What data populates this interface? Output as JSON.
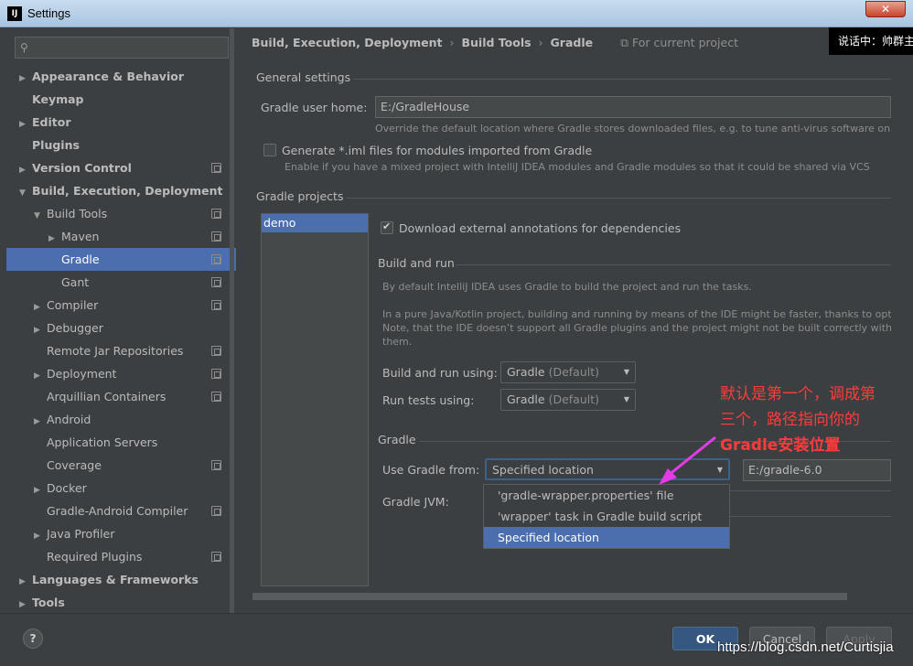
{
  "window": {
    "title": "Settings",
    "app_icon": "IJ",
    "close_symbol": "✕"
  },
  "sidebar": {
    "search_placeholder": "",
    "items": [
      {
        "label": "Appearance & Behavior",
        "arrow": "▶",
        "bold": true,
        "indent": 0,
        "copy": false
      },
      {
        "label": "Keymap",
        "arrow": "",
        "bold": true,
        "indent": 0,
        "copy": false
      },
      {
        "label": "Editor",
        "arrow": "▶",
        "bold": true,
        "indent": 0,
        "copy": false
      },
      {
        "label": "Plugins",
        "arrow": "",
        "bold": true,
        "indent": 0,
        "copy": false
      },
      {
        "label": "Version Control",
        "arrow": "▶",
        "bold": true,
        "indent": 0,
        "copy": true
      },
      {
        "label": "Build, Execution, Deployment",
        "arrow": "▼",
        "bold": true,
        "indent": 0,
        "copy": false
      },
      {
        "label": "Build Tools",
        "arrow": "▼",
        "bold": false,
        "indent": 1,
        "copy": true
      },
      {
        "label": "Maven",
        "arrow": "▶",
        "bold": false,
        "indent": 2,
        "copy": true
      },
      {
        "label": "Gradle",
        "arrow": "",
        "bold": false,
        "indent": 2,
        "copy": true,
        "selected": true
      },
      {
        "label": "Gant",
        "arrow": "",
        "bold": false,
        "indent": 2,
        "copy": true
      },
      {
        "label": "Compiler",
        "arrow": "▶",
        "bold": false,
        "indent": 1,
        "copy": true
      },
      {
        "label": "Debugger",
        "arrow": "▶",
        "bold": false,
        "indent": 1,
        "copy": false
      },
      {
        "label": "Remote Jar Repositories",
        "arrow": "",
        "bold": false,
        "indent": 1,
        "copy": true
      },
      {
        "label": "Deployment",
        "arrow": "▶",
        "bold": false,
        "indent": 1,
        "copy": true
      },
      {
        "label": "Arquillian Containers",
        "arrow": "",
        "bold": false,
        "indent": 1,
        "copy": true
      },
      {
        "label": "Android",
        "arrow": "▶",
        "bold": false,
        "indent": 1,
        "copy": false
      },
      {
        "label": "Application Servers",
        "arrow": "",
        "bold": false,
        "indent": 1,
        "copy": false
      },
      {
        "label": "Coverage",
        "arrow": "",
        "bold": false,
        "indent": 1,
        "copy": true
      },
      {
        "label": "Docker",
        "arrow": "▶",
        "bold": false,
        "indent": 1,
        "copy": false
      },
      {
        "label": "Gradle-Android Compiler",
        "arrow": "",
        "bold": false,
        "indent": 1,
        "copy": true
      },
      {
        "label": "Java Profiler",
        "arrow": "▶",
        "bold": false,
        "indent": 1,
        "copy": false
      },
      {
        "label": "Required Plugins",
        "arrow": "",
        "bold": false,
        "indent": 1,
        "copy": true
      },
      {
        "label": "Languages & Frameworks",
        "arrow": "▶",
        "bold": true,
        "indent": 0,
        "copy": false
      },
      {
        "label": "Tools",
        "arrow": "▶",
        "bold": true,
        "indent": 0,
        "copy": false
      }
    ]
  },
  "breadcrumb": {
    "parts": [
      "Build, Execution, Deployment",
      "Build Tools",
      "Gradle"
    ],
    "separator": "›",
    "project_scope": "For current project"
  },
  "general": {
    "title": "General settings",
    "user_home_label": "Gradle user home:",
    "user_home_value": "E:/GradleHouse",
    "user_home_hint": "Override the default location where Gradle stores downloaded files, e.g. to tune anti-virus software on Wind",
    "iml_label": "Generate *.iml files for modules imported from Gradle",
    "iml_hint": "Enable if you have a mixed project with IntelliJ IDEA modules and Gradle modules so that it could be shared via VCS",
    "iml_checked": false
  },
  "projects": {
    "title": "Gradle projects",
    "list": [
      "demo"
    ],
    "download_annotations_label": "Download external annotations for dependencies",
    "download_annotations_checked": true
  },
  "build_run": {
    "title": "Build and run",
    "desc1": "By default IntelliJ IDEA uses Gradle to build the project and run the tasks.",
    "desc2": "In a pure Java/Kotlin project, building and running by means of the IDE might be faster, thanks to optimiza",
    "desc3": "Note, that the IDE doesn’t support all Gradle plugins and the project might not be built correctly with sor",
    "desc4": "them.",
    "build_using_label": "Build and run using:",
    "build_using_value": "Gradle",
    "build_using_muted": "(Default)",
    "tests_using_label": "Run tests using:",
    "tests_using_value": "Gradle",
    "tests_using_muted": "(Default)"
  },
  "gradle": {
    "title": "Gradle",
    "use_from_label": "Use Gradle from:",
    "use_from_value": "Specified location",
    "location_value": "E:/gradle-6.0",
    "jvm_label": "Gradle JVM:",
    "options": [
      "'gradle-wrapper.properties' file",
      "'wrapper' task in Gradle build script",
      "Specified location"
    ],
    "selected_option": 2
  },
  "buttons": {
    "help": "?",
    "ok": "OK",
    "cancel": "Cancel",
    "apply": "Apply"
  },
  "overlay": {
    "tooltip": "说话中：帅群主",
    "annotation_line1": "默认是第一个，调成第",
    "annotation_line2": "三个，路径指向你的",
    "annotation_line3": "Gradle安装位置",
    "watermark": "https://blog.csdn.net/Curtisjia",
    "annotation_color": "#ff3b3b",
    "arrow_color": "#e33ce6"
  }
}
